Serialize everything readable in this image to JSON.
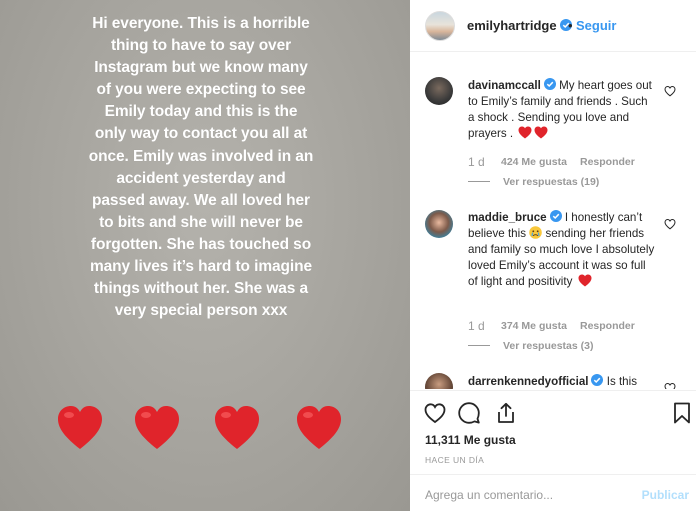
{
  "post": {
    "story_text": "Hi everyone. This is a horrible thing to have to say over Instagram but we know many of you were expecting to see Emily today and this is the only way to contact you all at once. Emily was involved in an accident yesterday and passed away. We all loved her to bits and she will never be forgotten. She has touched so many lives it’s hard to imagine things without her. She was a very special person xxx",
    "heart_color": "#e0242b"
  },
  "header": {
    "username": "emilyhartridge",
    "separator": "•",
    "follow_label": "Seguir"
  },
  "comments": [
    {
      "username": "davinamccall",
      "text": "My heart goes out to Emily’s family and friends . Such a shock . Sending you love and prayers .",
      "time": "1 d",
      "likes": "424 Me gusta",
      "reply_label": "Responder",
      "view_replies": "Ver respuestas (19)"
    },
    {
      "username": "maddie_bruce",
      "text_before_emoji": "I honestly can’t believe this",
      "text_after_emoji": "sending her friends and family so much love I absolutely loved Emily’s account it was so full of light and positivity",
      "time": "1 d",
      "likes": "374 Me gusta",
      "reply_label": "Responder",
      "view_replies": "Ver respuestas (3)"
    },
    {
      "username": "darrenkennedyofficial",
      "text": "Is this"
    }
  ],
  "actions": {
    "likes_count": "11,311 Me gusta",
    "post_time": "HACE UN DÍA",
    "comment_placeholder": "Agrega un comentario...",
    "publish_label": "Publicar"
  },
  "colors": {
    "link_blue": "#3897f0",
    "verified_blue": "#3897f0",
    "muted_gray": "#999999",
    "publish_disabled": "#b2dffc"
  }
}
